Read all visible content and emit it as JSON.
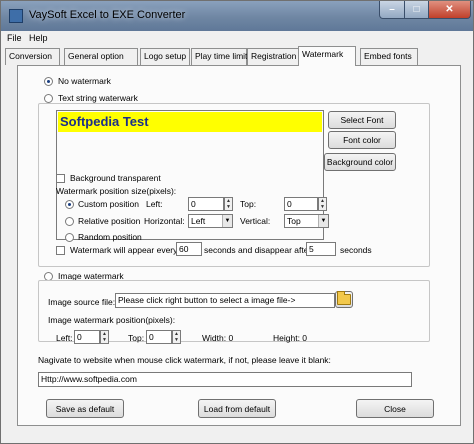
{
  "window": {
    "title": "VaySoft Excel to EXE Converter"
  },
  "menu": [
    "File",
    "Help"
  ],
  "tabs": [
    "Conversion",
    "General option",
    "Logo setup",
    "Play time limit",
    "Registration",
    "Watermark",
    "Embed fonts"
  ],
  "watermark": {
    "no_watermark_label": "No watermark",
    "text_watermark_label": "Text string waterwark",
    "text_value": "Softpedia Test",
    "select_font_label": "Select Font",
    "font_color_label": "Font color",
    "background_color_label": "Background color",
    "background_transparent_label": "Background transparent",
    "position_size_label": "Watermark position size(pixels):",
    "custom_position_label": "Custom position",
    "left_label": "Left:",
    "left_value": "0",
    "top_label": "Top:",
    "top_value": "0",
    "relative_position_label": "Relative position",
    "horizontal_label": "Horizontal:",
    "horizontal_value": "Left",
    "vertical_label": "Vertical:",
    "vertical_value": "Top",
    "random_position_label": "Random position",
    "appear_every_label": "Watermark will appear every",
    "appear_every_value": "60",
    "seconds_disappear_label": "seconds and disappear after",
    "disappear_after_value": "5",
    "seconds_label": "seconds"
  },
  "image_watermark": {
    "label": "Image watermark",
    "source_file_label": "Image source file:",
    "source_file_value": "Please click right button to select a image file->",
    "position_label": "Image watermark position(pixels):",
    "left_label": "Left:",
    "left_value": "0",
    "top_label": "Top:",
    "top_value": "0",
    "width_text": "Width: 0",
    "height_text": "Height: 0"
  },
  "navigate": {
    "label": "Nagivate to website when mouse click watermark, if not, please leave it blank:",
    "url_value": "Http://www.softpedia.com"
  },
  "buttons": {
    "save_default": "Save as default",
    "load_default": "Load from default",
    "close": "Close"
  }
}
